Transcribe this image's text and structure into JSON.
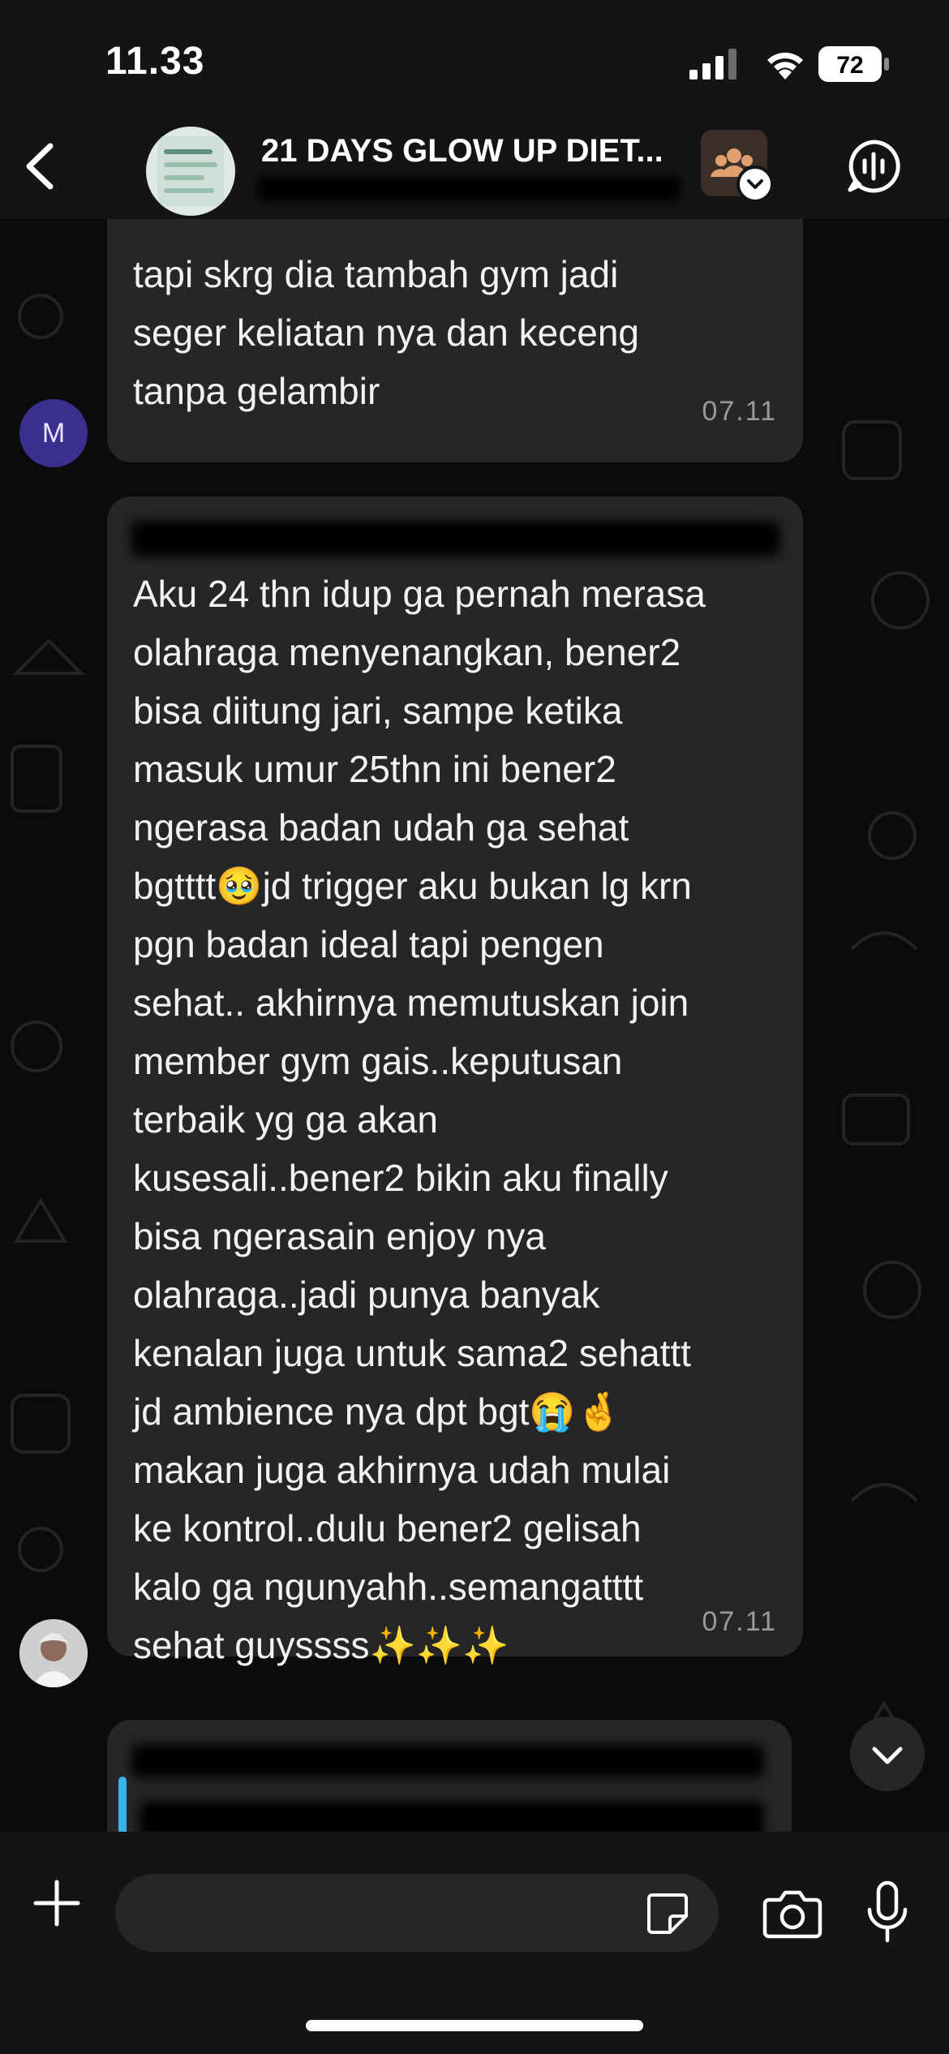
{
  "status_bar": {
    "time": "11.33",
    "battery": "72"
  },
  "header": {
    "title": "21 DAYS GLOW UP DIET..."
  },
  "messages": [
    {
      "text": "tapi skrg dia tambah gym jadi\nseger keliatan nya dan keceng\ntanpa gelambir",
      "time": "07.11",
      "avatar_initial": "M"
    },
    {
      "text": "Aku 24 thn idup ga pernah merasa\nolahraga menyenangkan, bener2\nbisa diitung jari, sampe ketika\nmasuk umur 25thn ini bener2\nngerasa badan udah ga sehat\nbgtttt🥹jd trigger aku bukan lg krn\npgn badan ideal tapi pengen\nsehat.. akhirnya  memutuskan join\nmember gym gais..keputusan\nterbaik yg ga akan\nkusesali..bener2 bikin aku finally\nbisa ngerasain enjoy nya\nolahraga..jadi punya banyak\nkenalan juga untuk sama2 sehattt\njd ambience nya dpt bgt😭🤞\nmakan juga akhirnya udah mulai\nke kontrol..dulu bener2 gelisah\nkalo ga ngunyahh..semangatttt\nsehat guyssss✨✨✨",
      "time": "07.11"
    }
  ],
  "input": {
    "placeholder": ""
  },
  "colors": {
    "background": "#0b0b0b",
    "bubble": "#262626",
    "quote_bar": "#3ab0e8",
    "avatar_m": "#3b2f8e"
  }
}
